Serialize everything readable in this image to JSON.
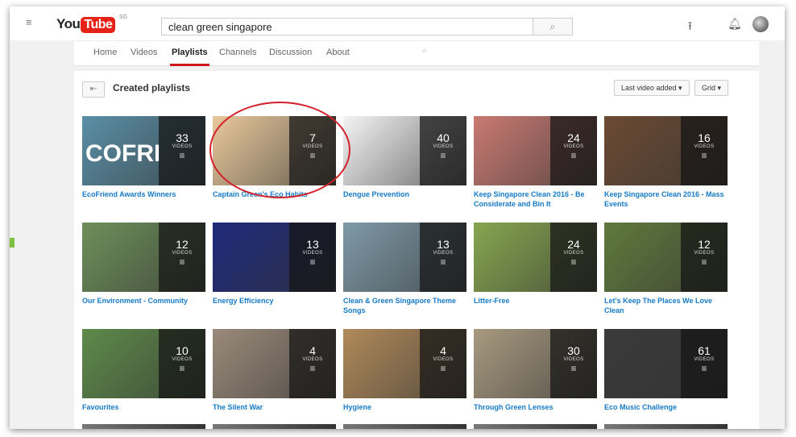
{
  "masthead": {
    "logo_you": "You",
    "logo_tube": "Tube",
    "logo_country": "SG",
    "search_value": "clean green singapore"
  },
  "channel_tabs": [
    "Home",
    "Videos",
    "Playlists",
    "Channels",
    "Discussion",
    "About"
  ],
  "active_tab": "Playlists",
  "section": {
    "title": "Created playlists",
    "sort_label": "Last video added ▾",
    "view_label": "Grid ▾"
  },
  "playlists": [
    {
      "title": "EcoFriend Awards Winners",
      "count": "33",
      "thumb_text": "COFRI",
      "color": "#5a8fa6"
    },
    {
      "title": "Captain Green's Eco Habits",
      "count": "7",
      "thumb_text": "",
      "color": "#e8c89b"
    },
    {
      "title": "Dengue Prevention",
      "count": "40",
      "thumb_text": "",
      "color": "#f4f4f4"
    },
    {
      "title": "Keep Singapore Clean 2016 - Be Considerate and Bin It",
      "count": "24",
      "thumb_text": "",
      "color": "#c97a72"
    },
    {
      "title": "Keep Singapore Clean 2016 - Mass Events",
      "count": "16",
      "thumb_text": "",
      "color": "#6b4a33"
    },
    {
      "title": "Our Environment - Community",
      "count": "12",
      "thumb_text": "",
      "color": "#6d8f5a"
    },
    {
      "title": "Energy Efficiency",
      "count": "13",
      "thumb_text": "",
      "color": "#1f2a7a"
    },
    {
      "title": "Clean & Green Singapore Theme Songs",
      "count": "13",
      "thumb_text": "",
      "color": "#7f9aa8"
    },
    {
      "title": "Litter-Free",
      "count": "24",
      "thumb_text": "",
      "color": "#86a64f"
    },
    {
      "title": "Let's Keep The Places We Love Clean",
      "count": "12",
      "thumb_text": "",
      "color": "#5f7a3c"
    },
    {
      "title": "Favourites",
      "count": "10",
      "thumb_text": "",
      "color": "#5e8a4a"
    },
    {
      "title": "The Silent War",
      "count": "4",
      "thumb_text": "",
      "color": "#9a8a7a"
    },
    {
      "title": "Hygiene",
      "count": "4",
      "thumb_text": "",
      "color": "#b08a5a"
    },
    {
      "title": "Through Green Lenses",
      "count": "30",
      "thumb_text": "",
      "color": "#a89a80"
    },
    {
      "title": "Eco Music Challenge",
      "count": "61",
      "thumb_text": "",
      "color": "#3a3a3a"
    }
  ],
  "videos_label": "VIDEOS",
  "colors": {
    "link": "#167ac6",
    "brand_red": "#e62117",
    "annotation": "#d3202a",
    "accent_green": "#7ac142"
  }
}
